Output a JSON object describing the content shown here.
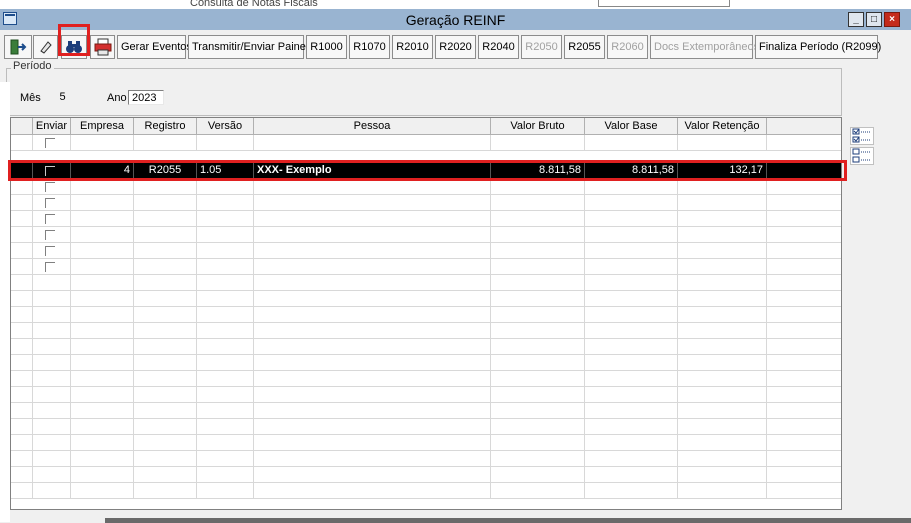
{
  "background_window": {
    "title": "Consulta de Notas Fiscais"
  },
  "window": {
    "title": "Geração REINF"
  },
  "toolbar": {
    "icon_buttons": [
      {
        "name": "exit-icon"
      },
      {
        "name": "eraser-icon"
      },
      {
        "name": "binoculars-icon"
      },
      {
        "name": "printer-icon"
      }
    ],
    "text_buttons": [
      {
        "label": "Gerar Eventos",
        "enabled": true
      },
      {
        "label": "Transmitir/Enviar Painel",
        "enabled": true
      },
      {
        "label": "R1000",
        "enabled": true
      },
      {
        "label": "R1070",
        "enabled": true
      },
      {
        "label": "R2010",
        "enabled": true
      },
      {
        "label": "R2020",
        "enabled": true
      },
      {
        "label": "R2040",
        "enabled": true
      },
      {
        "label": "R2050",
        "enabled": false
      },
      {
        "label": "R2055",
        "enabled": true
      },
      {
        "label": "R2060",
        "enabled": false
      },
      {
        "label": "Docs Extemporâneos",
        "enabled": false
      },
      {
        "label": "Finaliza Período (R2099)",
        "enabled": true
      }
    ]
  },
  "periodo": {
    "legend": "Período",
    "mes_label": "Mês",
    "mes_value": "5",
    "ano_label": "Ano",
    "ano_value": "2023"
  },
  "grid": {
    "columns": [
      "",
      "Enviar",
      "Empresa",
      "Registro",
      "Versão",
      "Pessoa",
      "Valor Bruto",
      "Valor Base",
      "Valor Retenção",
      ""
    ],
    "rows": [
      {
        "enviar": false,
        "empresa": "",
        "registro": "",
        "versao": "",
        "pessoa": "",
        "valor_bruto": "",
        "valor_base": "",
        "valor_retencao": ""
      },
      {
        "enviar": false,
        "empresa": "4",
        "registro": "R2055",
        "versao": "1.05",
        "pessoa": "XXX- Exemplo",
        "valor_bruto": "8.811,58",
        "valor_base": "8.811,58",
        "valor_retencao": "132,17",
        "selected": true
      },
      {
        "enviar": false
      },
      {
        "enviar": false
      },
      {
        "enviar": false
      },
      {
        "enviar": false
      },
      {
        "enviar": false
      },
      {
        "enviar": false
      }
    ],
    "empty_rows": 14
  },
  "side_buttons": [
    {
      "name": "check-all-icon"
    },
    {
      "name": "uncheck-all-icon"
    }
  ],
  "colors": {
    "highlight": "#e02020",
    "selected_row": "#000000",
    "titlebar": "#99b4d1"
  }
}
